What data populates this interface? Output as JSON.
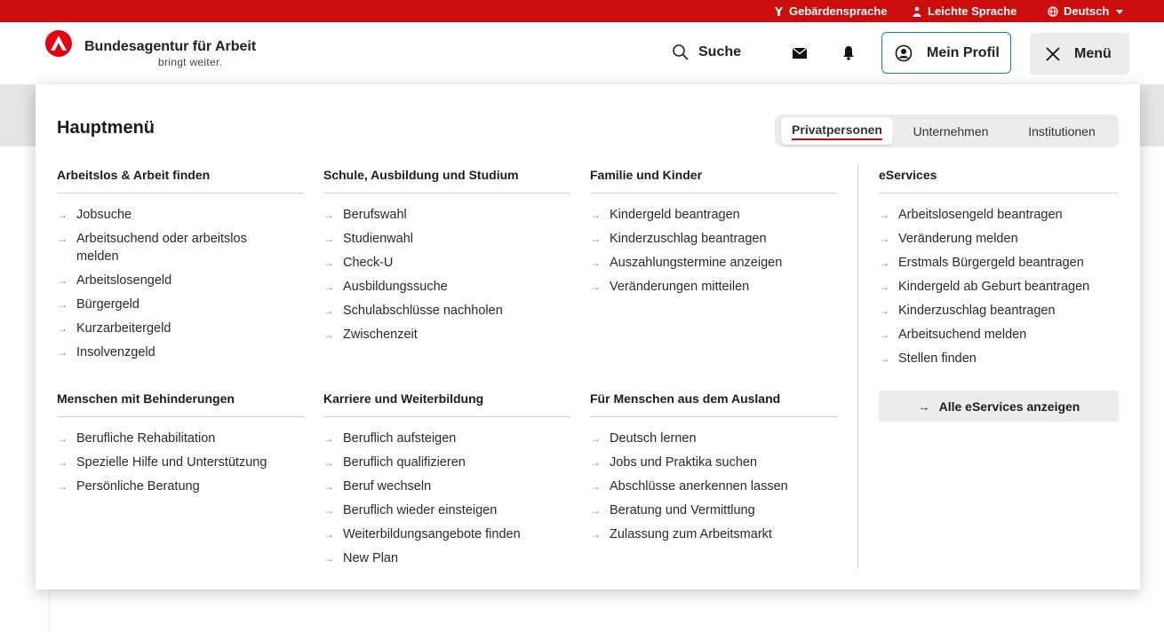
{
  "topbar": {
    "sign_language": "Gebärdensprache",
    "easy_language": "Leichte Sprache",
    "language": "Deutsch"
  },
  "header": {
    "brand_name": "Bundesagentur für Arbeit",
    "brand_tagline": "bringt weiter.",
    "search_label": "Suche",
    "profile_label": "Mein Profil",
    "menu_label": "Menü"
  },
  "menu": {
    "title": "Hauptmenü",
    "tabs": [
      "Privatpersonen",
      "Unternehmen",
      "Institutionen"
    ],
    "active_tab": "Privatpersonen",
    "columns": [
      {
        "heading": "Arbeitslos & Arbeit finden",
        "items": [
          "Jobsuche",
          "Arbeitsuchend oder arbeitslos melden",
          "Arbeitslosengeld",
          "Bürgergeld",
          "Kurzarbeitergeld",
          "Insolvenzgeld"
        ]
      },
      {
        "heading": "Schule, Ausbildung und Studium",
        "items": [
          "Berufswahl",
          "Studienwahl",
          "Check-U",
          "Ausbildungssuche",
          "Schulabschlüsse nachholen",
          "Zwischenzeit"
        ]
      },
      {
        "heading": "Familie und Kinder",
        "items": [
          "Kindergeld beantragen",
          "Kinderzuschlag beantragen",
          "Auszahlungstermine anzeigen",
          "Veränderungen mitteilen"
        ]
      },
      {
        "heading": "Menschen mit Behinderungen",
        "items": [
          "Berufliche Rehabilitation",
          "Spezielle Hilfe und Unterstützung",
          "Persönliche Beratung"
        ]
      },
      {
        "heading": "Karriere und Weiterbildung",
        "items": [
          "Beruflich aufsteigen",
          "Beruflich qualifizieren",
          "Beruf wechseln",
          "Beruflich wieder einsteigen",
          "Weiterbildungsangebote finden",
          "New Plan"
        ]
      },
      {
        "heading": "Für Menschen aus dem Ausland",
        "items": [
          "Deutsch lernen",
          "Jobs und Praktika suchen",
          "Abschlüsse anerkennen lassen",
          "Beratung und Vermittlung",
          "Zulassung zum Arbeitsmarkt"
        ]
      }
    ],
    "eservices": {
      "heading": "eServices",
      "items": [
        "Arbeitslosengeld beantragen",
        "Veränderung melden",
        "Erstmals Bürgergeld beantragen",
        "Kindergeld ab Geburt beantragen",
        "Kinderzuschlag beantragen",
        "Arbeitsuchend melden",
        "Stellen finden"
      ],
      "all_label": "Alle eServices anzeigen"
    }
  },
  "colors": {
    "brand_red": "#cc0d0d",
    "logo_red": "#e3000f",
    "profile_border": "#1d75c8"
  },
  "icons": [
    "hand-sign-icon",
    "person-icon",
    "globe-icon",
    "chevron-down-icon",
    "logo-icon",
    "search-icon",
    "mail-icon",
    "bell-icon",
    "user-circle-icon",
    "close-icon",
    "arrow-right-icon"
  ]
}
